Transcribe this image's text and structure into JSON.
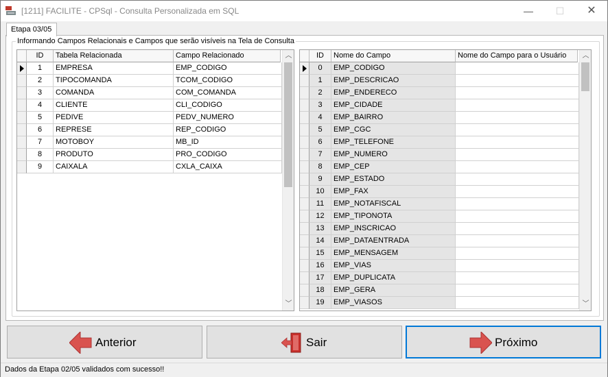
{
  "window": {
    "title": "[1211] FACILITE - CPSql - Consulta Personalizada em SQL",
    "minimize_glyph": "—",
    "maximize_glyph": "☐",
    "close_glyph": "✕"
  },
  "tab": {
    "label": "Etapa 03/05"
  },
  "group": {
    "label": "Informando Campos Relacionais e Campos que serão visíveis na Tela de Consulta"
  },
  "left_grid": {
    "columns": [
      "ID",
      "Tabela Relacionada",
      "Campo Relacionado"
    ],
    "rows": [
      {
        "id": "1",
        "table": "EMPRESA",
        "field": "EMP_CODIGO"
      },
      {
        "id": "2",
        "table": "TIPOCOMANDA",
        "field": "TCOM_CODIGO"
      },
      {
        "id": "3",
        "table": "COMANDA",
        "field": "COM_COMANDA"
      },
      {
        "id": "4",
        "table": "CLIENTE",
        "field": "CLI_CODIGO"
      },
      {
        "id": "5",
        "table": "PEDIVE",
        "field": "PEDV_NUMERO"
      },
      {
        "id": "6",
        "table": "REPRESE",
        "field": "REP_CODIGO"
      },
      {
        "id": "7",
        "table": "MOTOBOY",
        "field": "MB_ID"
      },
      {
        "id": "8",
        "table": "PRODUTO",
        "field": "PRO_CODIGO"
      },
      {
        "id": "9",
        "table": "CAIXALA",
        "field": "CXLA_CAIXA"
      }
    ]
  },
  "right_grid": {
    "columns": [
      "ID",
      "Nome do Campo",
      "Nome do Campo para o Usuário"
    ],
    "rows": [
      {
        "id": "0",
        "name": "EMP_CODIGO",
        "user_name": ""
      },
      {
        "id": "1",
        "name": "EMP_DESCRICAO",
        "user_name": ""
      },
      {
        "id": "2",
        "name": "EMP_ENDERECO",
        "user_name": ""
      },
      {
        "id": "3",
        "name": "EMP_CIDADE",
        "user_name": ""
      },
      {
        "id": "4",
        "name": "EMP_BAIRRO",
        "user_name": ""
      },
      {
        "id": "5",
        "name": "EMP_CGC",
        "user_name": ""
      },
      {
        "id": "6",
        "name": "EMP_TELEFONE",
        "user_name": ""
      },
      {
        "id": "7",
        "name": "EMP_NUMERO",
        "user_name": ""
      },
      {
        "id": "8",
        "name": "EMP_CEP",
        "user_name": ""
      },
      {
        "id": "9",
        "name": "EMP_ESTADO",
        "user_name": ""
      },
      {
        "id": "10",
        "name": "EMP_FAX",
        "user_name": ""
      },
      {
        "id": "11",
        "name": "EMP_NOTAFISCAL",
        "user_name": ""
      },
      {
        "id": "12",
        "name": "EMP_TIPONOTA",
        "user_name": ""
      },
      {
        "id": "13",
        "name": "EMP_INSCRICAO",
        "user_name": ""
      },
      {
        "id": "14",
        "name": "EMP_DATAENTRADA",
        "user_name": ""
      },
      {
        "id": "15",
        "name": "EMP_MENSAGEM",
        "user_name": ""
      },
      {
        "id": "16",
        "name": "EMP_VIAS",
        "user_name": ""
      },
      {
        "id": "17",
        "name": "EMP_DUPLICATA",
        "user_name": ""
      },
      {
        "id": "18",
        "name": "EMP_GERA",
        "user_name": ""
      },
      {
        "id": "19",
        "name": "EMP_VIASOS",
        "user_name": ""
      }
    ]
  },
  "buttons": {
    "previous": "Anterior",
    "exit": "Sair",
    "next": "Próximo"
  },
  "status": {
    "text": "Dados da Etapa 02/05 validados com sucesso!!"
  },
  "colors": {
    "focus": "#0078d7",
    "arrow_red": "#d9534f"
  }
}
